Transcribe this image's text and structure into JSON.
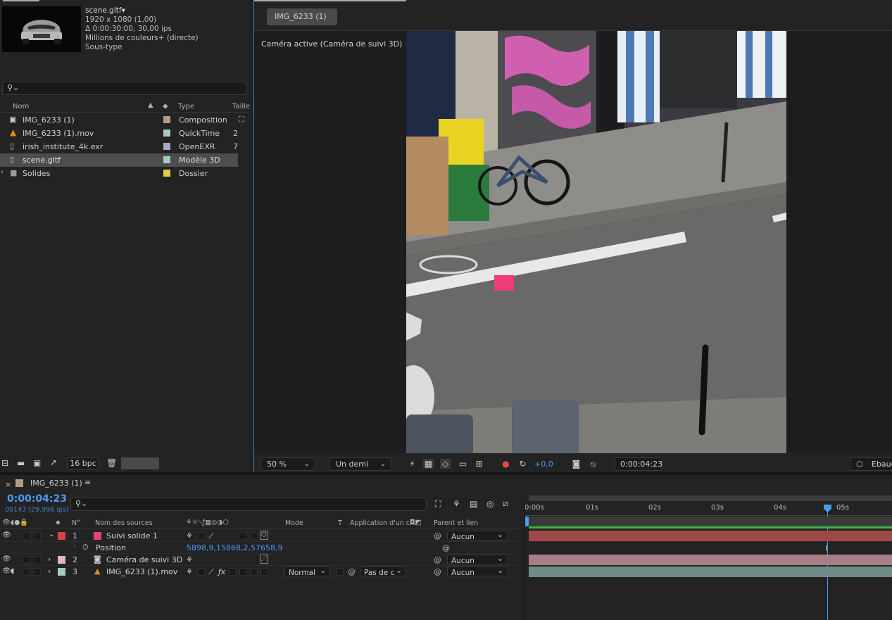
{
  "project": {
    "footage": {
      "name": "scene.gltf",
      "resolution": "1920 x 1080 (1,00)",
      "duration": "Δ 0:00:30:00, 30,00 ips",
      "colors": "Millions de couleurs+ (directe)",
      "subtype": "Sous-type"
    },
    "columns": {
      "name": "Nom",
      "type": "Type",
      "size": "Taille"
    },
    "items": [
      {
        "name": "IMG_6233 (1)",
        "type": "Composition",
        "size": "",
        "color": "#b49a7e",
        "selected": false
      },
      {
        "name": "IMG_6233 (1).mov",
        "type": "QuickTime",
        "size": "2",
        "color": "#a6c9c1",
        "selected": false
      },
      {
        "name": "irish_institute_4k.exr",
        "type": "OpenEXR",
        "size": "7",
        "color": "#a9a7c8",
        "selected": false
      },
      {
        "name": "scene.gltf",
        "type": "Modèle 3D",
        "size": "",
        "color": "#a6c9c1",
        "selected": true
      },
      {
        "name": "Solides",
        "type": "Dossier",
        "size": "",
        "color": "#e0cf3e",
        "selected": false
      }
    ],
    "bpc": "16 bpc"
  },
  "viewer": {
    "tab": "IMG_6233 (1)",
    "camera_label": "Caméra active (Caméra de suivi 3D)",
    "zoom": "50 %",
    "resolution": "Un demi",
    "exposure": "+0,0",
    "timecode": "0:00:04:23",
    "renderer": "Ebauc"
  },
  "timeline": {
    "tab": "IMG_6233 (1)",
    "tab_color": "#b49a7e",
    "timecode": "0:00:04:23",
    "frame_info": "00143 (29.996 ips)",
    "columns": {
      "num": "N°",
      "source": "Nom des sources",
      "mode": "Mode",
      "t": "T",
      "matte": "Application d'un c...",
      "parent": "Parent et lien"
    },
    "ruler": [
      "0:00s",
      "01s",
      "02s",
      "03s",
      "04s",
      "05s"
    ],
    "layers": [
      {
        "num": "1",
        "name": "Suivi solide 1",
        "color": "#e0427a",
        "label_color": "#d4473f",
        "parent": "Aucun",
        "bar_color": "#9e4848",
        "expanded": true
      },
      {
        "num": "2",
        "name": "Caméra de suivi 3D",
        "color": "",
        "label_color": "#e5b6c6",
        "parent": "Aucun",
        "bar_color": "#a77e86",
        "expanded": false
      },
      {
        "num": "3",
        "name": "IMG_6233 (1).mov",
        "color": "",
        "label_color": "#a6c9c1",
        "parent": "Aucun",
        "bar_color": "#6f8c88",
        "expanded": false,
        "mode": "Normal",
        "matte": "Pas de c"
      }
    ],
    "position_prop": {
      "label": "Position",
      "value": "5898,9,15868,2,57658,9"
    }
  }
}
